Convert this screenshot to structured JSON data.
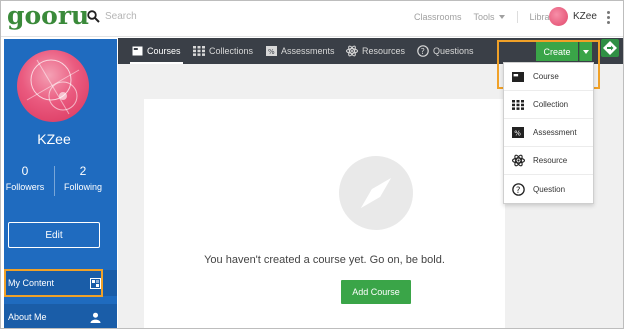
{
  "header": {
    "logo": "gooru",
    "search_placeholder": "Search",
    "nav": [
      "Classrooms",
      "Tools",
      "Library"
    ],
    "user_name": "KZee"
  },
  "sidebar": {
    "username": "KZee",
    "followers_count": "0",
    "followers_label": "Followers",
    "following_count": "2",
    "following_label": "Following",
    "edit_label": "Edit",
    "items": [
      {
        "label": "My Content",
        "icon": "my-content-icon"
      },
      {
        "label": "About Me",
        "icon": "person-icon"
      }
    ]
  },
  "tabs": [
    {
      "label": "Courses",
      "icon": "course-icon",
      "active": true
    },
    {
      "label": "Collections",
      "icon": "collection-icon",
      "active": false
    },
    {
      "label": "Assessments",
      "icon": "assessment-icon",
      "active": false
    },
    {
      "label": "Resources",
      "icon": "resource-icon",
      "active": false
    },
    {
      "label": "Questions",
      "icon": "question-icon",
      "active": false
    }
  ],
  "create": {
    "label": "Create",
    "menu": [
      {
        "label": "Course",
        "icon": "course-icon"
      },
      {
        "label": "Collection",
        "icon": "collection-icon"
      },
      {
        "label": "Assessment",
        "icon": "assessment-icon"
      },
      {
        "label": "Resource",
        "icon": "resource-icon"
      },
      {
        "label": "Question",
        "icon": "question-icon"
      }
    ]
  },
  "main": {
    "empty_message": "You haven't created a course yet. Go on, be bold.",
    "add_course_label": "Add Course"
  },
  "colors": {
    "brand_green": "#3aa548",
    "sidebar_blue": "#1f6bbf",
    "tab_bar": "#3a3f47",
    "highlight_orange": "#f0a128"
  }
}
